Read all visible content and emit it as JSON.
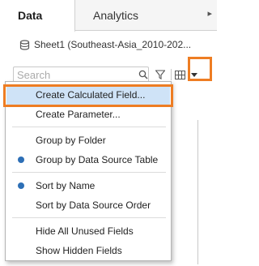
{
  "tabs": [
    {
      "label": "Data",
      "active": true
    },
    {
      "label": "Analytics",
      "active": false
    }
  ],
  "tab_menu_icon": "chevron-right-icon",
  "datasource": {
    "icon": "database-icon",
    "label": "Sheet1 (Southeast-Asia_2010-202..."
  },
  "search": {
    "placeholder": "Search",
    "value": ""
  },
  "toolbar_icons": [
    "search-icon",
    "filter-icon",
    "grid-view-icon",
    "dropdown-arrow-icon"
  ],
  "colors": {
    "highlight_outline": "#ee7d23",
    "menu_hover": "#cfe3f7",
    "radio_dot": "#2d6fb6"
  },
  "menu": {
    "items": [
      {
        "label": "Create Calculated Field...",
        "selected": false,
        "highlighted": true
      },
      {
        "label": "Create Parameter...",
        "selected": false
      },
      {
        "label": "Group by Folder",
        "selected": false
      },
      {
        "label": "Group by Data Source Table",
        "selected": true
      },
      {
        "label": "Sort by Name",
        "selected": true
      },
      {
        "label": "Sort by Data Source Order",
        "selected": false
      },
      {
        "label": "Hide All Unused Fields",
        "selected": false
      },
      {
        "label": "Show Hidden Fields",
        "selected": false
      }
    ]
  }
}
